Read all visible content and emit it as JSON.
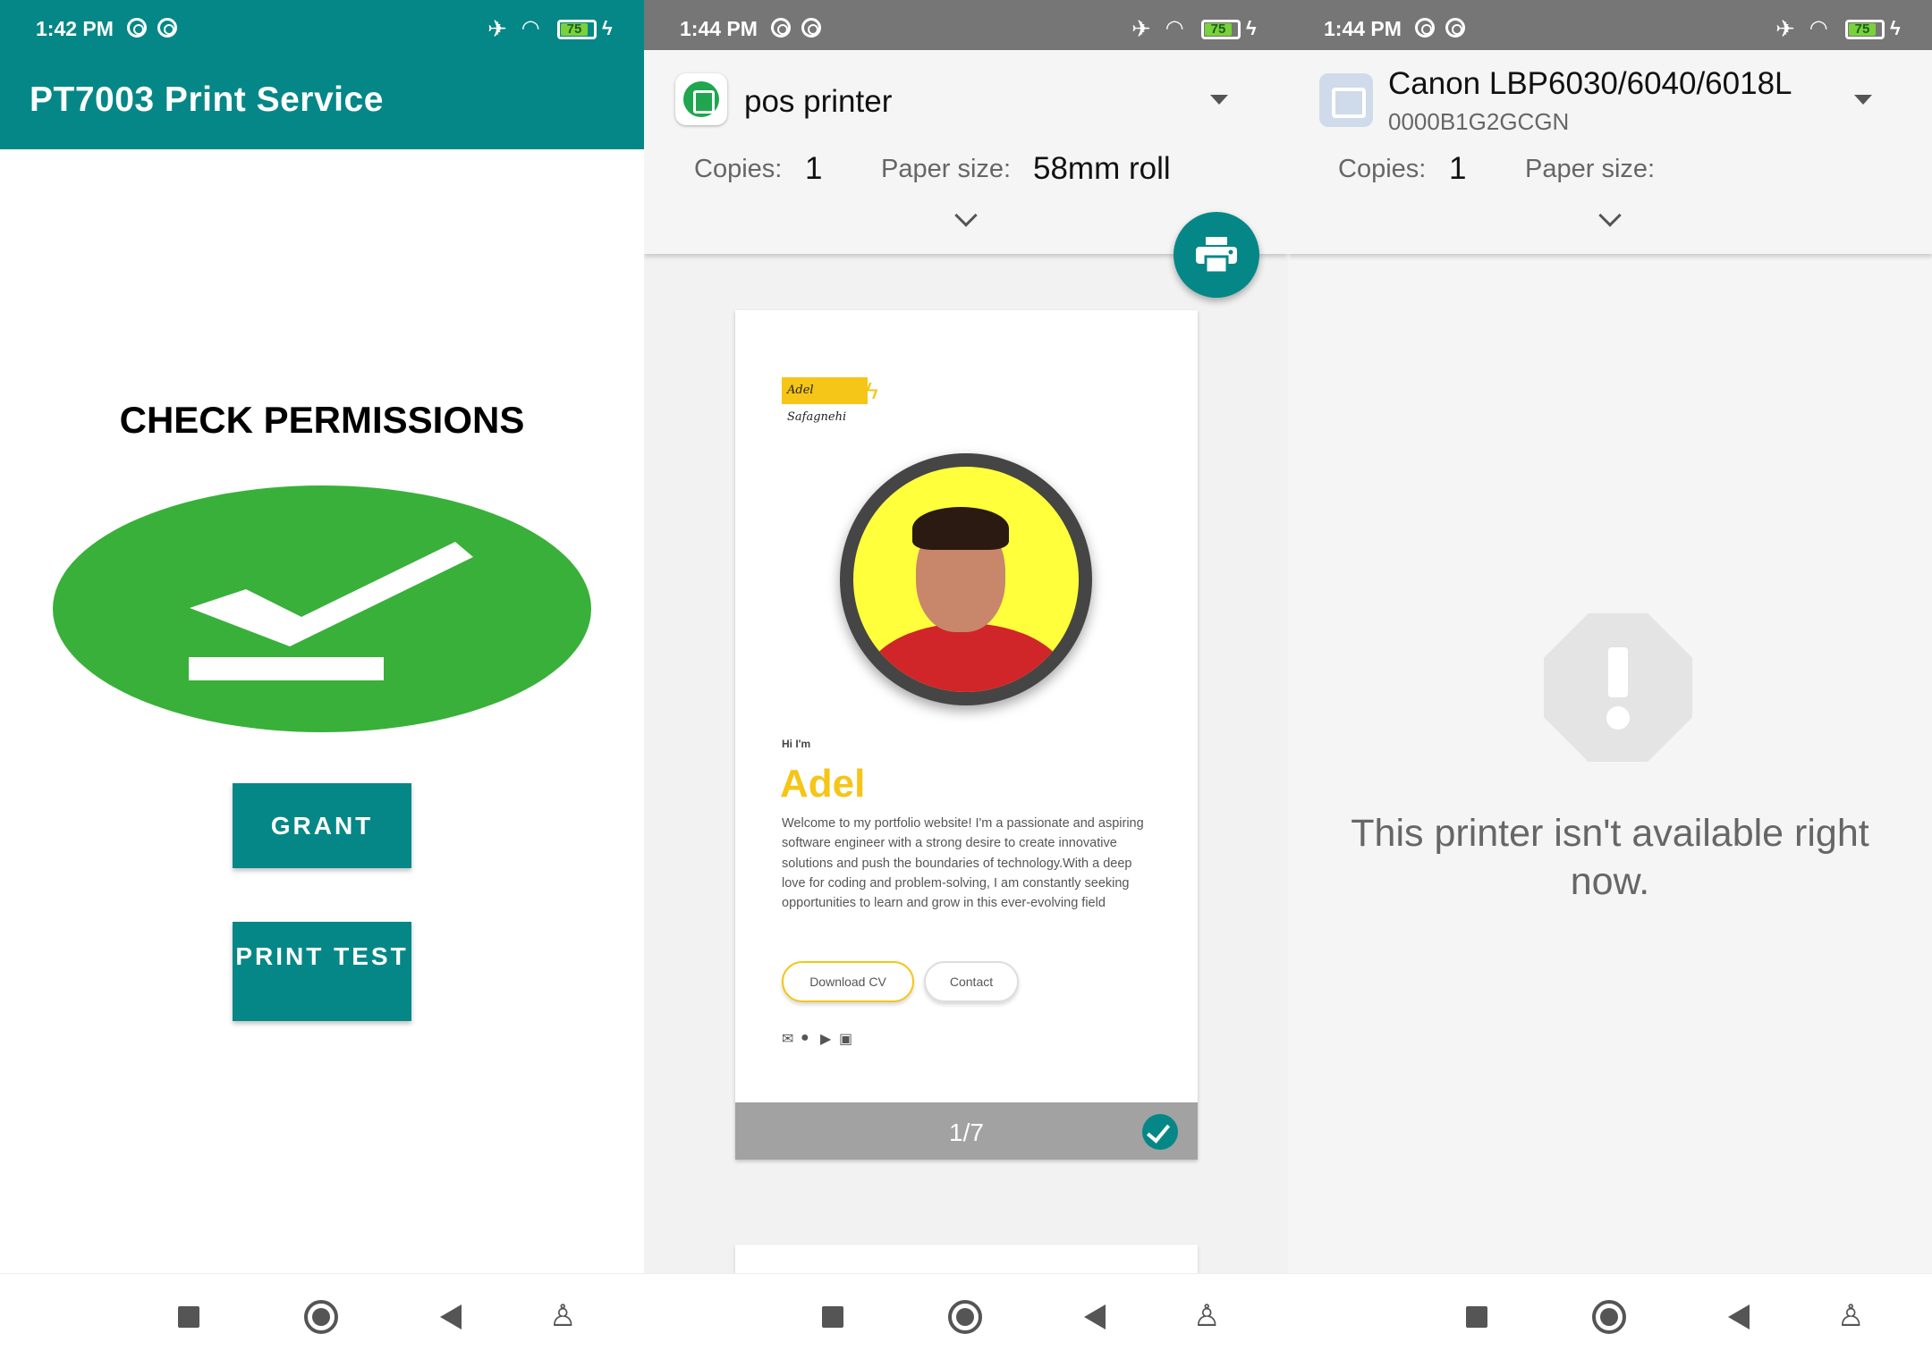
{
  "panel1": {
    "status": {
      "time": "1:42 PM",
      "battery": "75"
    },
    "appbar_title": "PT7003 Print Service",
    "heading": "CHECK PERMISSIONS",
    "grant_label": "GRANT",
    "print_test_label": "PRINT TEST"
  },
  "panel2": {
    "status": {
      "time": "1:44 PM",
      "battery": "75"
    },
    "printer_name": "pos printer",
    "copies_label": "Copies:",
    "copies_value": "1",
    "paper_size_label": "Paper size:",
    "paper_size_value": "58mm roll",
    "preview": {
      "logo_text": "Adel Safagnehi",
      "hi": "Hi I'm",
      "name": "Adel",
      "bio": "Welcome to my portfolio website! I'm a passionate and aspiring software engineer with a strong desire to create innovative solutions and push the boundaries of technology.With a deep love for coding and problem-solving, I am constantly seeking opportunities to learn and grow in this ever-evolving field",
      "download_cv": "Download CV",
      "contact": "Contact",
      "page_indicator": "1/7"
    }
  },
  "panel3": {
    "status": {
      "time": "1:44 PM",
      "battery": "75"
    },
    "printer_name": "Canon LBP6030/6040/6018L",
    "printer_id": "0000B1G2GCGN",
    "copies_label": "Copies:",
    "copies_value": "1",
    "paper_size_label": "Paper size:",
    "message": "This printer isn't available right now."
  },
  "colors": {
    "teal": "#068787",
    "success_green": "#39b03a",
    "accent_yellow": "#f5c518",
    "status_gray": "#767676"
  },
  "icons": [
    "dnd-icon",
    "airplane-icon",
    "wifi-icon",
    "battery-icon",
    "charging-icon",
    "checkmark-icon",
    "printer-icon",
    "dropdown-icon",
    "chevron-down-icon",
    "warning-octagon-icon",
    "recents-icon",
    "home-icon",
    "back-icon",
    "accessibility-icon"
  ]
}
